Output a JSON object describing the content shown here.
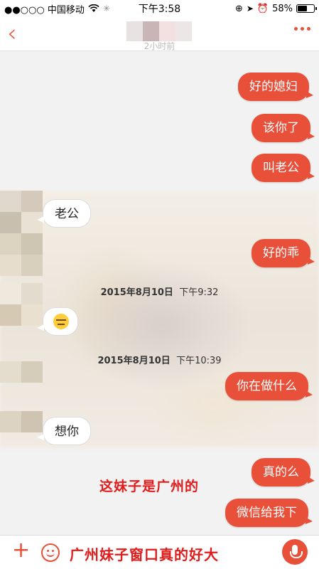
{
  "status_bar": {
    "carrier": "●●○○○ 中国移动",
    "time": "下午3:58",
    "battery": "58%",
    "battery_level": 0.58,
    "icons": [
      "wifi-icon",
      "loading-icon",
      "orientation-lock-icon",
      "location-icon",
      "alarm-icon",
      "battery-icon"
    ]
  },
  "nav": {
    "back_icon": "chevron-left-icon",
    "more_icon": "more-dots-icon",
    "prev_time_hint": "2小时前"
  },
  "messages": [
    {
      "dir": "out",
      "text": "好的媳妇"
    },
    {
      "dir": "out",
      "text": "该你了"
    },
    {
      "dir": "out",
      "text": "叫老公"
    },
    {
      "dir": "in",
      "text": "老公"
    },
    {
      "dir": "out",
      "text": "好的乖"
    },
    {
      "dir": "in",
      "text": "",
      "emoji": "expressionless-face-icon"
    },
    {
      "dir": "out",
      "text": "你在做什么"
    },
    {
      "dir": "in",
      "text": "想你"
    },
    {
      "dir": "out",
      "text": "真的么"
    },
    {
      "dir": "out",
      "text": "微信给我下"
    }
  ],
  "timestamps": [
    {
      "date": "2015年8月10日",
      "time": "下午9:32"
    },
    {
      "date": "2015年8月10日",
      "time": "下午10:39"
    }
  ],
  "overlay_caption": "这妹子是广州的",
  "bottom_bar": {
    "input_text": "广州妹子窗口真的好大",
    "plus_icon": "plus-icon",
    "emoji_icon": "smile-icon",
    "mic_icon": "microphone-icon"
  },
  "colors": {
    "accent": "#e8503a",
    "caption_red": "#e21b1b"
  }
}
